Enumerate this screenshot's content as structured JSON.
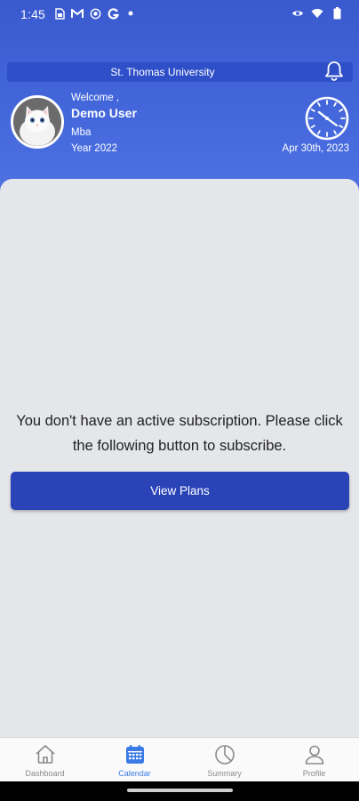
{
  "status_bar": {
    "time": "1:45",
    "left_icons": [
      "sim-icon",
      "gmail-icon",
      "target-icon",
      "google-icon",
      "dot-icon"
    ],
    "right_icons": [
      "eye-icon",
      "wifi-icon",
      "battery-icon"
    ]
  },
  "header": {
    "university": "St. Thomas University",
    "welcome": "Welcome ,",
    "user_name": "Demo User",
    "program": "Mba",
    "year": "Year 2022",
    "date": "Apr 30th, 2023"
  },
  "main": {
    "message": "You don't have an active subscription. Please click the following button to subscribe.",
    "view_plans_label": "View Plans"
  },
  "bottom_nav": {
    "items": [
      {
        "label": "Dashboard",
        "icon": "home-icon",
        "active": false
      },
      {
        "label": "Calendar",
        "icon": "calendar-icon",
        "active": true
      },
      {
        "label": "Summary",
        "icon": "pie-chart-icon",
        "active": false
      },
      {
        "label": "Profile",
        "icon": "person-icon",
        "active": false
      }
    ]
  },
  "colors": {
    "header_blue": "#4367db",
    "button_blue": "#2a44b8",
    "active_nav": "#3b7be8",
    "background": "#e5e6ea"
  }
}
